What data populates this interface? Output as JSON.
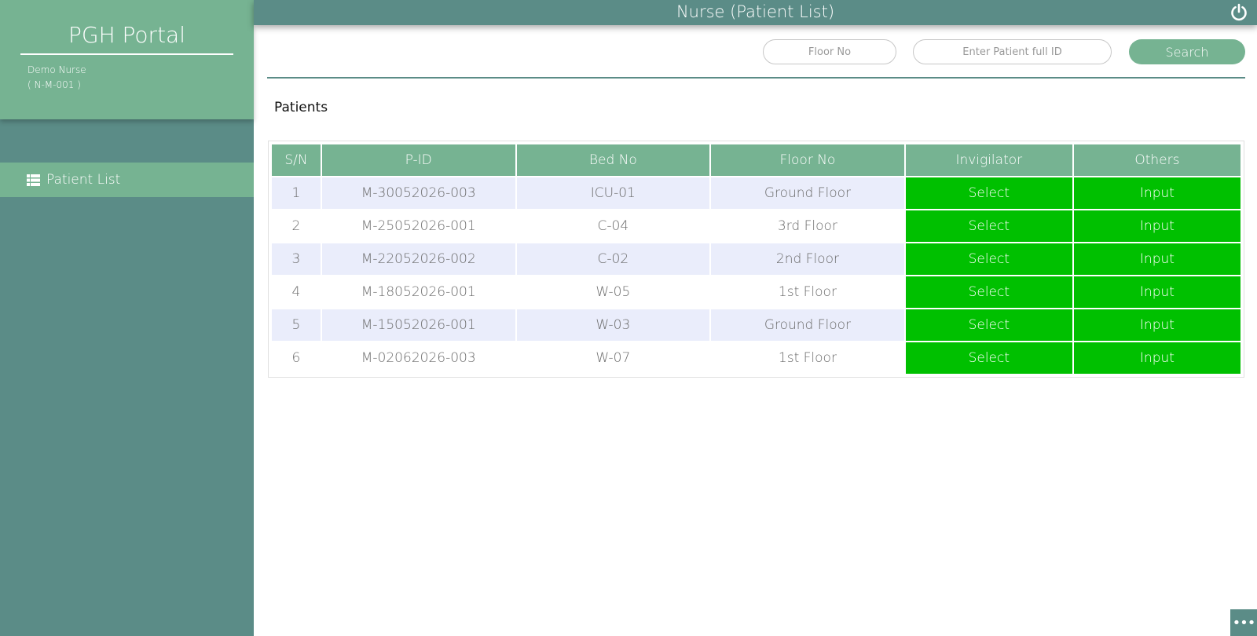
{
  "app": {
    "brand": "PGH Portal",
    "user_name": "Demo Nurse",
    "user_id": "( N-M-001 )"
  },
  "sidebar": {
    "items": [
      {
        "label": "Patient List",
        "icon": "list-icon"
      }
    ]
  },
  "header": {
    "title": "Nurse (Patient List)",
    "logout_icon": "power-icon"
  },
  "search": {
    "floor_placeholder": "Floor No",
    "patient_placeholder": "Enter Patient full ID",
    "button_label": "Search"
  },
  "main": {
    "section_title": "Patients"
  },
  "table": {
    "columns": [
      "S/N",
      "P-ID",
      "Bed No",
      "Floor No",
      "Invigilator",
      "Others"
    ],
    "rows": [
      {
        "sn": "1",
        "pid": "M-30052026-003",
        "bed": "ICU-01",
        "floor": "Ground Floor",
        "invigilator": "Select",
        "others": "Input"
      },
      {
        "sn": "2",
        "pid": "M-25052026-001",
        "bed": "C-04",
        "floor": "3rd Floor",
        "invigilator": "Select",
        "others": "Input"
      },
      {
        "sn": "3",
        "pid": "M-22052026-002",
        "bed": "C-02",
        "floor": "2nd Floor",
        "invigilator": "Select",
        "others": "Input"
      },
      {
        "sn": "4",
        "pid": "M-18052026-001",
        "bed": "W-05",
        "floor": "1st Floor",
        "invigilator": "Select",
        "others": "Input"
      },
      {
        "sn": "5",
        "pid": "M-15052026-001",
        "bed": "W-03",
        "floor": "Ground Floor",
        "invigilator": "Select",
        "others": "Input"
      },
      {
        "sn": "6",
        "pid": "M-02062026-003",
        "bed": "W-07",
        "floor": "1st Floor",
        "invigilator": "Select",
        "others": "Input"
      }
    ]
  },
  "colors": {
    "sidebar_bg": "#5b8c87",
    "accent_green": "#76b392",
    "action_green": "#00c000",
    "row_stripe": "#eaedfb"
  },
  "footer": {
    "more_icon": "more-dots-icon",
    "more_label": "•••"
  }
}
